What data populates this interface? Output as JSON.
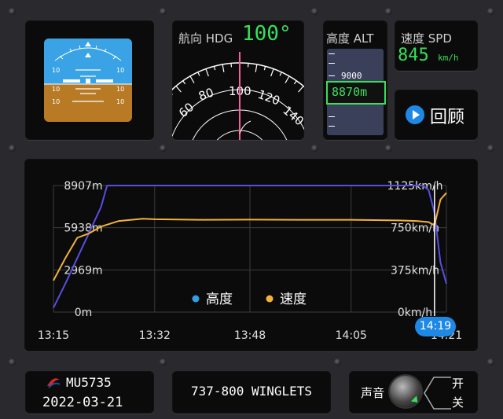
{
  "colors": {
    "sky": "#3aa3e6",
    "ground": "#b87a25",
    "segment_green": "#37e05a",
    "altitude_line": "#5a4de0",
    "speed_line": "#f3b23c",
    "heading_pointer": "#ff5aa0",
    "time_badge": "#1e88e5"
  },
  "attitude": {
    "pitch_labels": [
      "10",
      "10",
      "10",
      "10",
      "10",
      "10"
    ]
  },
  "heading": {
    "label": "航向 HDG",
    "value": "100°",
    "ticks": [
      "60",
      "80",
      "100",
      "120",
      "140"
    ]
  },
  "altitude": {
    "label": "高度 ALT",
    "scale_mark": "9000",
    "value": "8870m"
  },
  "speed": {
    "label": "速度 SPD",
    "value": "845",
    "unit": "km/h"
  },
  "replay": {
    "icon": "play-icon",
    "label": "回顾"
  },
  "chart_data": {
    "type": "line",
    "x_labels": [
      "13:15",
      "13:32",
      "13:48",
      "14:05",
      "14:21"
    ],
    "y_left_labels": [
      "8907m",
      "5938m",
      "2969m",
      "0m"
    ],
    "y_right_labels": [
      "1125km/h",
      "750km/h",
      "375km/h",
      "0km/h"
    ],
    "ylim_altitude": [
      0,
      8907
    ],
    "ylim_speed": [
      0,
      1125
    ],
    "grid": true,
    "legend_position": "center",
    "series": [
      {
        "name": "高度",
        "color": "#5a4de0",
        "x": [
          "13:15",
          "13:17",
          "13:19",
          "13:21",
          "13:23",
          "13:24",
          "13:26",
          "13:32",
          "13:48",
          "14:05",
          "14:16",
          "14:17",
          "14:18",
          "14:19",
          "14:20",
          "14:21"
        ],
        "values": [
          300,
          2000,
          3800,
          5600,
          7400,
          8900,
          8907,
          8907,
          8907,
          8907,
          8907,
          8900,
          8600,
          7000,
          3500,
          2000
        ]
      },
      {
        "name": "速度",
        "color": "#f3b23c",
        "x": [
          "13:15",
          "13:17",
          "13:19",
          "13:21",
          "13:23",
          "13:26",
          "13:30",
          "13:32",
          "13:40",
          "13:48",
          "13:56",
          "14:05",
          "14:13",
          "14:16",
          "14:18",
          "14:19",
          "14:20",
          "14:21"
        ],
        "values": [
          280,
          480,
          660,
          700,
          760,
          810,
          830,
          825,
          820,
          822,
          820,
          820,
          815,
          810,
          800,
          770,
          1000,
          1060
        ]
      }
    ],
    "cursor_time": "14:19"
  },
  "flight": {
    "logo": "china-eastern-logo",
    "number": "MU5735",
    "date": "2022-03-21"
  },
  "aircraft": {
    "type": "737-800 WINGLETS"
  },
  "sound": {
    "label": "声音",
    "on": "开",
    "off": "关"
  }
}
